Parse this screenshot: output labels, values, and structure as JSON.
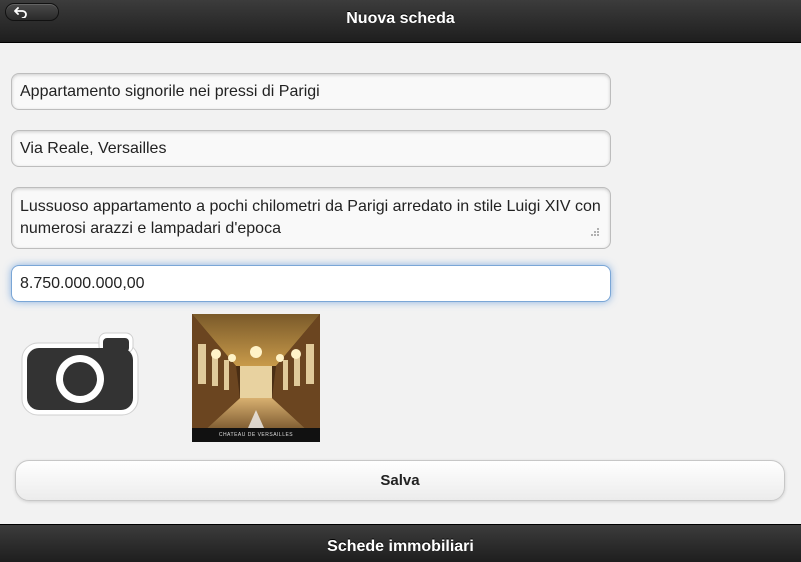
{
  "header": {
    "title": "Nuova scheda",
    "back_icon": "undo-arrow-icon"
  },
  "form": {
    "title_value": "Appartamento signorile nei pressi di Parigi",
    "address_value": "Via Reale, Versailles",
    "description_value": "Lussuoso appartamento a pochi chilometri da Parigi arredato in stile Luigi XIV con numerosi arazzi e lampadari d'epoca",
    "price_value": "8.750.000.000,00",
    "camera_icon": "camera-icon",
    "photo_caption": "CHATEAU DE VERSAILLES",
    "save_label": "Salva"
  },
  "footer": {
    "title": "Schede immobiliari"
  },
  "colors": {
    "bar": "#2b2b2b",
    "background": "#f2f2f2",
    "focus": "#7aa6d6"
  }
}
